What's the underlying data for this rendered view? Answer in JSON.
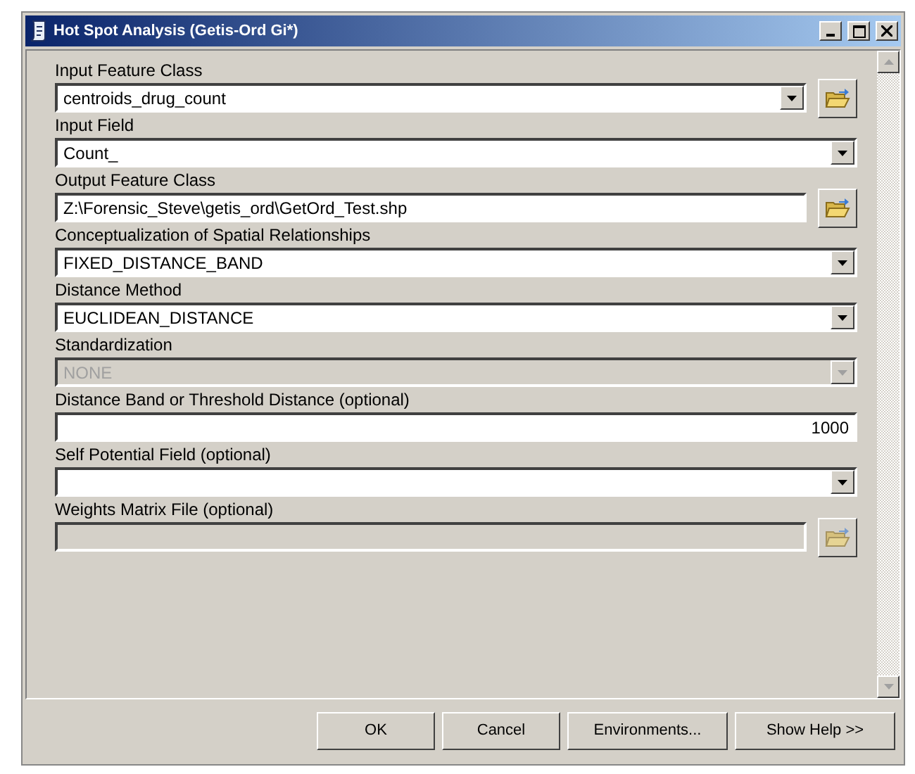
{
  "window": {
    "title": "Hot Spot Analysis (Getis-Ord Gi*)"
  },
  "parameters": [
    {
      "label": "Input Feature Class",
      "kind": "dropdown",
      "value": "centroids_drug_count",
      "disabled": false,
      "browse": true
    },
    {
      "label": "Input Field",
      "kind": "dropdown",
      "value": "Count_",
      "disabled": false,
      "browse": false
    },
    {
      "label": "Output Feature Class",
      "kind": "text",
      "value": "Z:\\Forensic_Steve\\getis_ord\\GetOrd_Test.shp",
      "disabled": false,
      "browse": true
    },
    {
      "label": "Conceptualization of Spatial Relationships",
      "kind": "dropdown",
      "value": "FIXED_DISTANCE_BAND",
      "disabled": false,
      "browse": false
    },
    {
      "label": "Distance Method",
      "kind": "dropdown",
      "value": "EUCLIDEAN_DISTANCE",
      "disabled": false,
      "browse": false
    },
    {
      "label": "Standardization",
      "kind": "dropdown",
      "value": "NONE",
      "disabled": true,
      "browse": false
    },
    {
      "label": "Distance Band or Threshold Distance (optional)",
      "kind": "number",
      "value": "1000",
      "disabled": false,
      "browse": false
    },
    {
      "label": "Self Potential Field (optional)",
      "kind": "dropdown",
      "disabled": false,
      "browse": false
    },
    {
      "label": "Weights Matrix File (optional)",
      "kind": "text",
      "disabled": true,
      "browse": true
    }
  ],
  "buttons": [
    "OK",
    "Cancel",
    "Environments...",
    "Show Help >>"
  ]
}
